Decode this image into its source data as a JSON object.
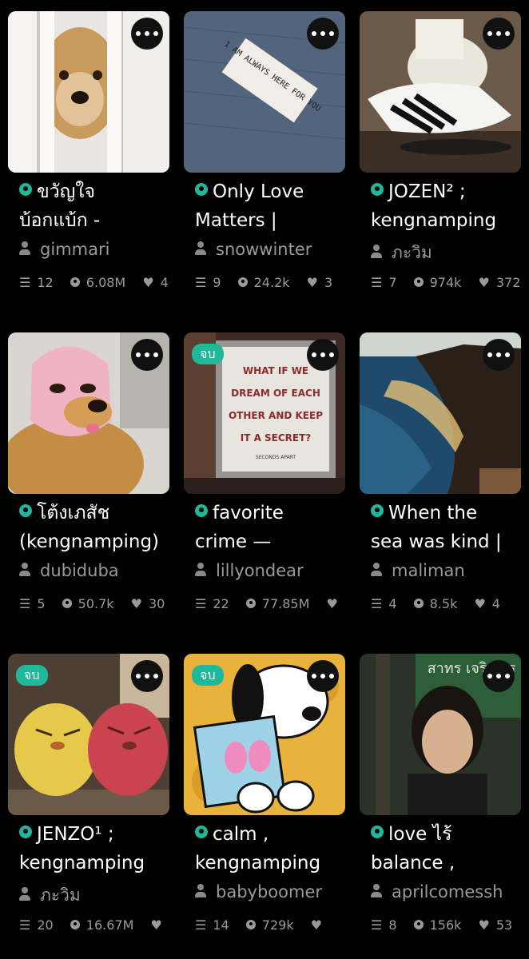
{
  "books": [
    {
      "title1": "ขวัญใจ",
      "title2": "บ้อกแบ้ก -",
      "author": "gimmari",
      "parts": "12",
      "reads": "6.08M",
      "votes": "4",
      "completed": false,
      "cover": "dog-peeking"
    },
    {
      "title1": "Only Love",
      "title2": "Matters |",
      "author": "snowwinter",
      "parts": "9",
      "reads": "24.2k",
      "votes": "3",
      "completed": false,
      "cover": "denim-label",
      "cover_text": "I AM ALWAYS HERE FOR YOU"
    },
    {
      "title1": "JOZEN² ;",
      "title2": "kengnamping",
      "author": "ภะวิม",
      "parts": "7",
      "reads": "974k",
      "votes": "372",
      "completed": false,
      "cover": "sneakers"
    },
    {
      "title1": "โต้งเภสัช",
      "title2": "(kengnamping)",
      "author": "dubiduba",
      "parts": "5",
      "reads": "50.7k",
      "votes": "30",
      "completed": false,
      "cover": "dog-balaclava"
    },
    {
      "title1": "favorite",
      "title2": "crime —",
      "author": "lillyondear",
      "parts": "22",
      "reads": "77.85M",
      "votes": "",
      "completed": true,
      "cover": "sign-billboard",
      "cover_text": [
        "WHAT IF WE",
        "DREAM OF EACH",
        "OTHER AND KEEP",
        "IT A SECRET?",
        "SECONDS APART"
      ]
    },
    {
      "title1": "When the",
      "title2": "sea was kind |",
      "author": "maliman",
      "parts": "4",
      "reads": "8.5k",
      "votes": "4",
      "completed": false,
      "cover": "sea-cliff"
    },
    {
      "title1": "JENZO¹ ;",
      "title2": "kengnamping",
      "author": "ภะวิม",
      "parts": "20",
      "reads": "16.67M",
      "votes": "",
      "completed": true,
      "cover": "plush-birds"
    },
    {
      "title1": "calm ,",
      "title2": "kengnamping",
      "author": "babyboomer",
      "parts": "14",
      "reads": "729k",
      "votes": "",
      "completed": true,
      "cover": "snoopy-reading"
    },
    {
      "title1": "love ไร้",
      "title2": "balance ,",
      "author": "aprilcomessh",
      "parts": "8",
      "reads": "156k",
      "votes": "53",
      "completed": false,
      "cover": "girl-portrait",
      "cover_text": "สาทร เจริญกรุ"
    }
  ],
  "completed_label": "จบ",
  "colors": {
    "accent": "#1fb89a",
    "background": "#000000",
    "muted": "#9a9a9a"
  }
}
